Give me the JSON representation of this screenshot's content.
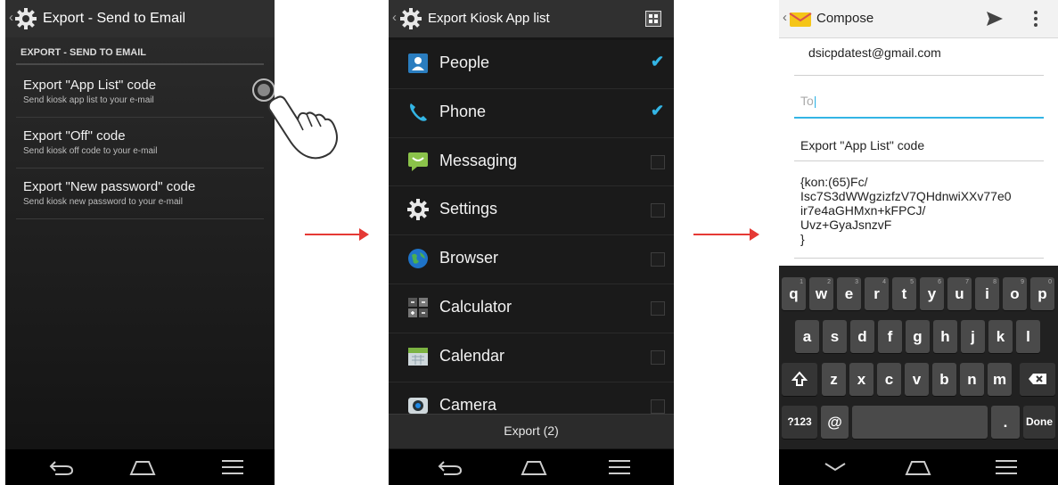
{
  "screen1": {
    "title": "Export - Send to Email",
    "section_header": "EXPORT - SEND TO EMAIL",
    "items": [
      {
        "title": "Export \"App List\" code",
        "subtitle": "Send kiosk app list to your e-mail"
      },
      {
        "title": "Export \"Off\" code",
        "subtitle": "Send kiosk off code to your e-mail"
      },
      {
        "title": "Export \"New password\" code",
        "subtitle": "Send kiosk new password to your e-mail"
      }
    ]
  },
  "screen2": {
    "title": "Export Kiosk App list",
    "apps": [
      {
        "label": "People",
        "checked": true,
        "icon": "people-icon"
      },
      {
        "label": "Phone",
        "checked": true,
        "icon": "phone-icon"
      },
      {
        "label": "Messaging",
        "checked": false,
        "icon": "messaging-icon"
      },
      {
        "label": "Settings",
        "checked": false,
        "icon": "settings-icon"
      },
      {
        "label": "Browser",
        "checked": false,
        "icon": "browser-icon"
      },
      {
        "label": "Calculator",
        "checked": false,
        "icon": "calculator-icon"
      },
      {
        "label": "Calendar",
        "checked": false,
        "icon": "calendar-icon"
      },
      {
        "label": "Camera",
        "checked": false,
        "icon": "camera-icon"
      }
    ],
    "export_button": "Export (2)"
  },
  "screen3": {
    "title": "Compose",
    "from": "dsicpdatest@gmail.com",
    "to_placeholder": "To",
    "subject": "Export \"App List\" code",
    "body_lines": [
      "{kon:(65)Fc/",
      "Isc7S3dWWgzizfzV7QHdnwiXXv77e0",
      "ir7e4aGHMxn+kFPCJ/",
      "Uvz+GyaJsnzvF",
      "}"
    ],
    "keyboard": {
      "row1": [
        "q",
        "w",
        "e",
        "r",
        "t",
        "y",
        "u",
        "i",
        "o",
        "p"
      ],
      "row1_hints": [
        "1",
        "2",
        "3",
        "4",
        "5",
        "6",
        "7",
        "8",
        "9",
        "0"
      ],
      "row2": [
        "a",
        "s",
        "d",
        "f",
        "g",
        "h",
        "j",
        "k",
        "l"
      ],
      "row3": [
        "z",
        "x",
        "c",
        "v",
        "b",
        "n",
        "m"
      ],
      "symbols_key": "?123",
      "at_key": "@",
      "period_key": ".",
      "done_key": "Done"
    }
  },
  "colors": {
    "accent": "#33b5e5",
    "arrow": "#e53935"
  }
}
